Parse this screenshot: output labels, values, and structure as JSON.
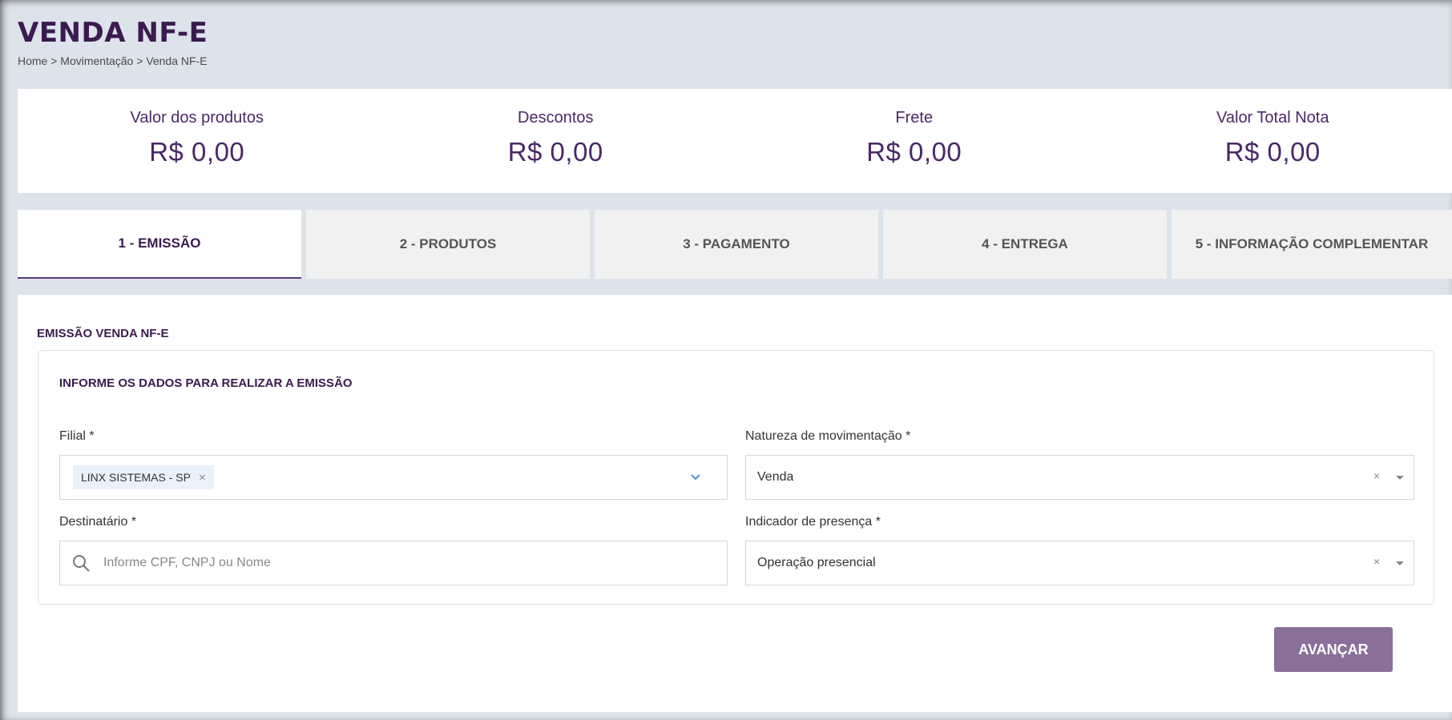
{
  "header": {
    "title": "VENDA NF-E",
    "breadcrumb": "Home > Movimentação > Venda NF-E"
  },
  "totals": [
    {
      "label": "Valor dos produtos",
      "value": "R$ 0,00"
    },
    {
      "label": "Descontos",
      "value": "R$ 0,00"
    },
    {
      "label": "Frete",
      "value": "R$ 0,00"
    },
    {
      "label": "Valor Total Nota",
      "value": "R$ 0,00"
    }
  ],
  "tabs": [
    {
      "label": "1 - EMISSÃO",
      "active": true
    },
    {
      "label": "2 - PRODUTOS",
      "active": false
    },
    {
      "label": "3 - PAGAMENTO",
      "active": false
    },
    {
      "label": "4 - ENTREGA",
      "active": false
    },
    {
      "label": "5 - INFORMAÇÃO COMPLEMENTAR",
      "active": false
    }
  ],
  "form": {
    "section_title": "EMISSÃO VENDA NF-E",
    "card_title": "INFORME OS DADOS PARA REALIZAR A EMISSÃO",
    "filial": {
      "label": "Filial *",
      "chip": "LINX SISTEMAS - SP",
      "chip_remove": "×"
    },
    "natureza": {
      "label": "Natureza de movimentação *",
      "value": "Venda",
      "clear": "×"
    },
    "destinatario": {
      "label": "Destinatário *",
      "value": "",
      "placeholder": "Informe CPF, CNPJ ou Nome"
    },
    "indicador": {
      "label": "Indicador de presença *",
      "value": "Operação presencial",
      "clear": "×"
    },
    "advance_label": "AVANÇAR"
  },
  "colors": {
    "title": "#3b1b4f",
    "accent": "#4a2866",
    "button": "#8a7099",
    "chip_bg": "#e9f1fb",
    "chevron": "#4a90d9",
    "background": "#dde3eb"
  },
  "icons": {
    "filial_dropdown": "chevron-down-icon",
    "search": "search-icon",
    "select_caret": "caret-down-icon"
  }
}
